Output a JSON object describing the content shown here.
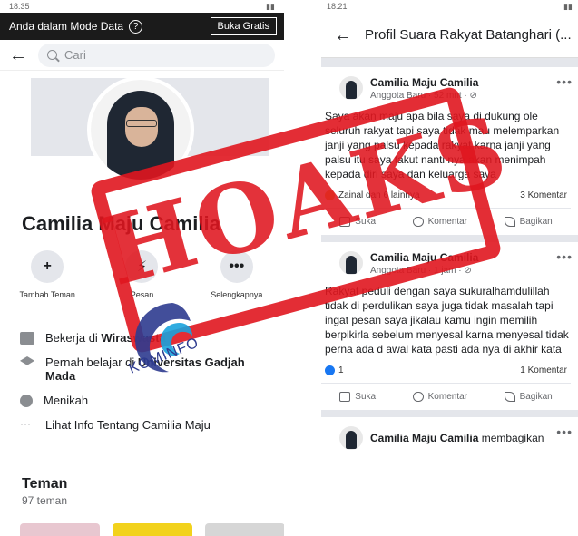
{
  "left": {
    "status_time": "18.35",
    "data_mode": {
      "text": "Anda dalam Mode Data",
      "help": "?",
      "button": "Buka Gratis"
    },
    "search": {
      "placeholder": "Cari"
    },
    "profile_name": "Camilia Maju Camilia",
    "actions": [
      {
        "label": "Tambah Teman",
        "icon": "add-friend-icon",
        "glyph": "+"
      },
      {
        "label": "Pesan",
        "icon": "messenger-icon",
        "glyph": "⚡"
      },
      {
        "label": "Selengkapnya",
        "icon": "more-icon",
        "glyph": "•••"
      }
    ],
    "info": [
      {
        "icon": "work-icon",
        "prefix": "Bekerja di ",
        "bold": "Wiraswasta"
      },
      {
        "icon": "education-icon",
        "prefix": "Pernah belajar di ",
        "bold": "Universitas Gadjah Mada"
      },
      {
        "icon": "heart-icon",
        "prefix": "Menikah",
        "bold": ""
      },
      {
        "icon": "more-dots-icon",
        "prefix": "Lihat Info Tentang Camilia Maju",
        "bold": ""
      }
    ],
    "friends": {
      "title": "Teman",
      "count": "97 teman"
    }
  },
  "right": {
    "status_time": "18.21",
    "header_title": "Profil Suara Rakyat Batanghari (...",
    "posts": [
      {
        "author": "Camilia Maju Camilia",
        "meta": "Anggota Baru · 52 mnt · ⊘",
        "text": "Saya akan maju apa bila saya di dukung ole seluruh rakyat tapi saya tidak mau melemparkan janji yang palsu kepada rakyat karna janji yang palsu itu saya takut nanti nya akan menimpah kepada diri saya dan keluarga saya",
        "reactions": "Zainal dan 6 lainnya",
        "comments": "3 Komentar"
      },
      {
        "author": "Camilia Maju Camilia",
        "meta": "Anggota Baru · 1 jam · ⊘",
        "text": "Rakyat peduli dengan saya sukuralhamdulillah tidak di perdulikan saya juga tidak masalah tapi ingat pesan saya jikalau kamu ingin memilih berpikirla sebelum menyesal karna menyesal tidak perna ada d awal kata pasti ada nya di akhir kata",
        "reactions": "1",
        "comments": "1 Komentar"
      }
    ],
    "buttons": {
      "like": "Suka",
      "comment": "Komentar",
      "share": "Bagikan"
    },
    "third_post": {
      "author": "Camilia Maju Camilia",
      "suffix": " membagikan"
    }
  },
  "overlay": {
    "stamp": "HOAKS",
    "logo": "KOMINFO"
  },
  "colors": {
    "stamp": "#e0161f",
    "logo": "#2e3b8f",
    "fb_blue": "#1877f2"
  }
}
